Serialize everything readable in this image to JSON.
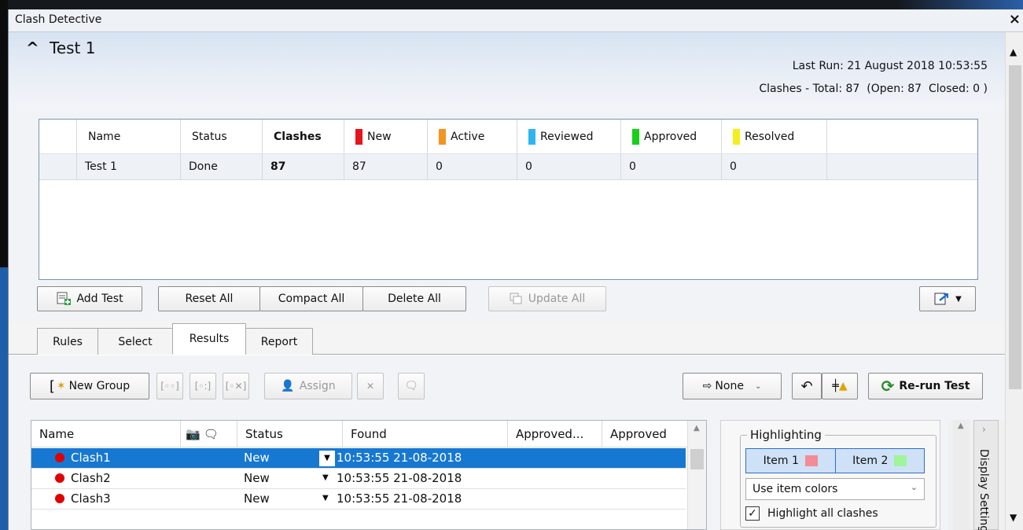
{
  "window": {
    "title": "Clash Detective",
    "close_icon": "×"
  },
  "header": {
    "test_name": "Test 1",
    "last_run": "Last Run:  21 August 2018 10:53:55",
    "clashes_summary": "Clashes - Total: 87  (Open: 87  Closed: 0 )"
  },
  "tests_table": {
    "columns": [
      "Name",
      "Status",
      "Clashes",
      "New",
      "Active",
      "Reviewed",
      "Approved",
      "Resolved"
    ],
    "status_colors": {
      "New": "#e8141b",
      "Active": "#f5931f",
      "Reviewed": "#2eb6ef",
      "Approved": "#19cf19",
      "Resolved": "#f4ee1b"
    },
    "row": {
      "name": "Test 1",
      "status": "Done",
      "clashes": "87",
      "new": "87",
      "active": "0",
      "reviewed": "0",
      "approved": "0",
      "resolved": "0"
    }
  },
  "buttons": {
    "add_test": "Add Test",
    "reset_all": "Reset All",
    "compact_all": "Compact All",
    "delete_all": "Delete All",
    "update_all": "Update All"
  },
  "tabs": [
    "Rules",
    "Select",
    "Results",
    "Report"
  ],
  "results_toolbar": {
    "new_group": "New Group",
    "assign": "Assign",
    "none": "None",
    "rerun": "Re-run Test"
  },
  "results_table": {
    "columns": [
      "Name",
      "Status",
      "Found",
      "Approved...",
      "Approved"
    ],
    "rows": [
      {
        "name": "Clash1",
        "status": "New",
        "found": "10:53:55 21-08-2018"
      },
      {
        "name": "Clash2",
        "status": "New",
        "found": "10:53:55 21-08-2018"
      },
      {
        "name": "Clash3",
        "status": "New",
        "found": "10:53:55 21-08-2018"
      }
    ]
  },
  "display": {
    "highlighting": "Highlighting",
    "item1": "Item 1",
    "item2": "Item 2",
    "item1_color": "#f28b96",
    "item2_color": "#9ef59a",
    "use_item_colors": "Use item colors",
    "highlight_all": "Highlight all clashes",
    "tab_label": "Display Settings"
  }
}
